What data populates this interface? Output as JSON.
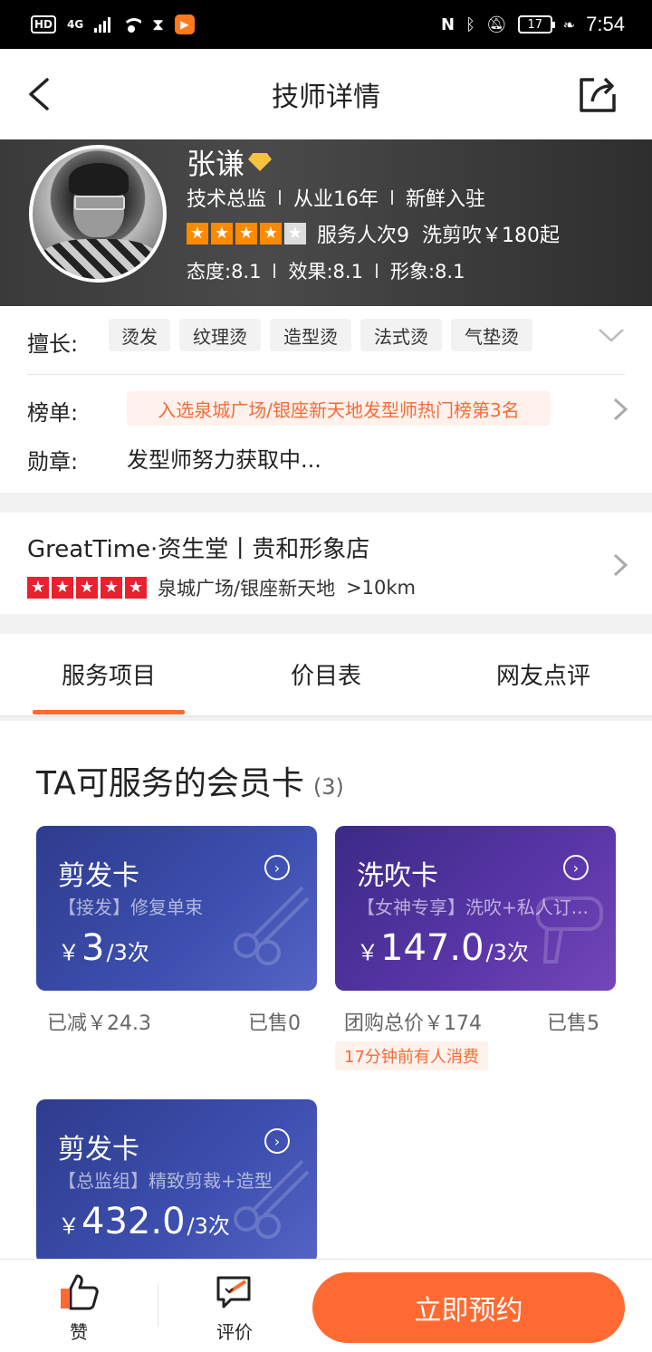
{
  "status_bar": {
    "hd": "HD",
    "network": "4G",
    "time": "7:54",
    "battery": "17",
    "icons": [
      "signal-icon",
      "wifi-icon",
      "hourglass-icon",
      "video-icon",
      "nfc-icon",
      "bluetooth-icon",
      "mute-icon",
      "battery-icon",
      "leaf-icon"
    ]
  },
  "nav": {
    "title": "技师详情",
    "back_icon": "back-icon",
    "share_icon": "share-icon"
  },
  "profile": {
    "name": "张谦",
    "position": "技术总监",
    "experience": "从业16年",
    "status": "新鲜入驻",
    "rating_stars": 4,
    "service_count": "服务人次9",
    "price": "洗剪吹￥180起",
    "score_attitude": "态度:8.1",
    "score_effect": "效果:8.1",
    "score_image": "形象:8.1"
  },
  "info": {
    "specialty_label": "擅长:",
    "tags": [
      "烫发",
      "纹理烫",
      "造型烫",
      "法式烫",
      "气垫烫"
    ],
    "ranking_label": "榜单:",
    "ranking_text": "入选泉城广场/银座新天地发型师热门榜第3名",
    "medal_label": "勋章:",
    "medal_text": "发型师努力获取中..."
  },
  "store": {
    "name": "GreatTime·资生堂丨贵和形象店",
    "rating_stars": 5,
    "location": "泉城广场/银座新天地",
    "distance": ">10km"
  },
  "tabs": [
    {
      "label": "服务项目",
      "active": true
    },
    {
      "label": "价目表",
      "active": false
    },
    {
      "label": "网友点评",
      "active": false
    }
  ],
  "section": {
    "title": "TA可服务的会员卡",
    "count": "(3)"
  },
  "cards": [
    {
      "title": "剪发卡",
      "subtitle": "【接发】修复单束",
      "currency": "￥",
      "price": "3",
      "unit": "/3次",
      "foot_left": "已减￥24.3",
      "foot_right": "已售0",
      "hot": ""
    },
    {
      "title": "洗吹卡",
      "subtitle": "【女神专享】洗吹+私人订...",
      "currency": "￥",
      "price": "147.0",
      "unit": "/3次",
      "foot_left": "团购总价￥174",
      "foot_right": "已售5",
      "hot": "17分钟前有人消费"
    },
    {
      "title": "剪发卡",
      "subtitle": "【总监组】精致剪裁+造型",
      "currency": "￥",
      "price": "432.0",
      "unit": "/3次",
      "foot_left": "",
      "foot_right": "",
      "hot": ""
    }
  ],
  "bottom": {
    "like_label": "赞",
    "review_label": "评价",
    "book_label": "立即预约"
  },
  "colors": {
    "accent": "#ff6a33",
    "star_orange": "#ff8a00",
    "store_star_red": "#e8212f",
    "card_blue": "#3d4fb0",
    "card_purple": "#5a36a8"
  }
}
